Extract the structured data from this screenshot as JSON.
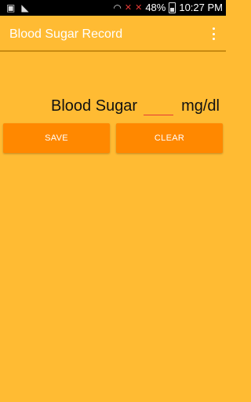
{
  "status_bar": {
    "battery_percent": "48%",
    "time": "10:27 PM"
  },
  "app_bar": {
    "title": "Blood Sugar Record"
  },
  "form": {
    "label": "Blood Sugar",
    "input_value": "",
    "unit": "mg/dl"
  },
  "buttons": {
    "save_label": "SAVE",
    "clear_label": "CLEAR"
  },
  "colors": {
    "background": "#FFBB33",
    "button": "#FF8800",
    "input_underline": "#E53935"
  }
}
